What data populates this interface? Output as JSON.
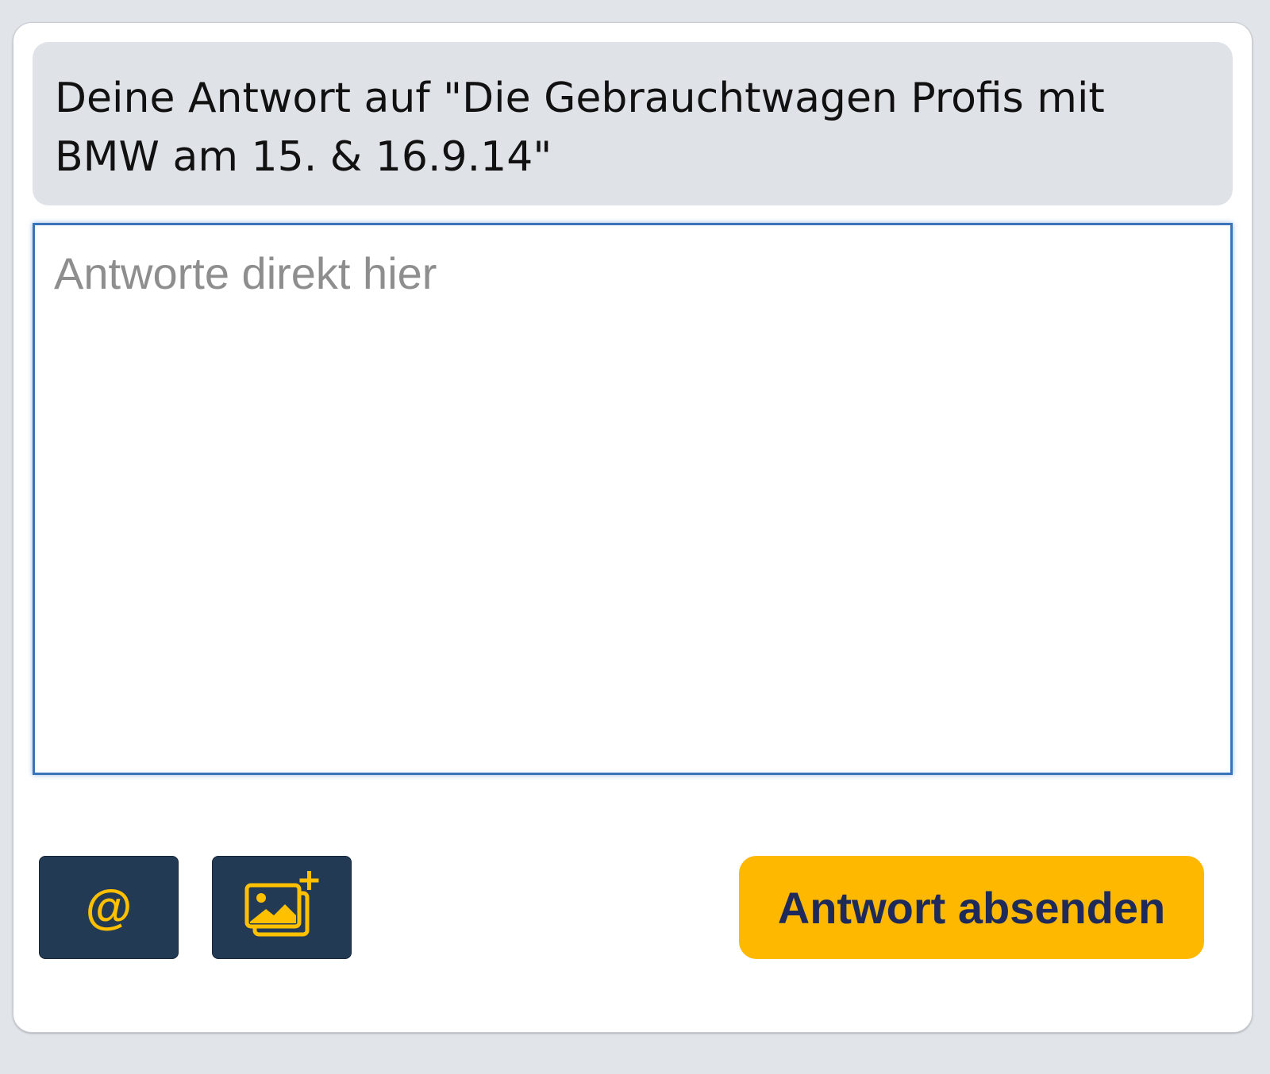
{
  "reply_form": {
    "heading": "Deine Antwort auf \"Die Gebrauchtwagen Profis mit BMW am 15. & 16.9.14\"",
    "textarea": {
      "value": "",
      "placeholder": "Antworte direkt hier"
    },
    "toolbar": {
      "mention_icon": "at-sign-icon",
      "mention_glyph": "@",
      "image_icon": "add-image-icon"
    },
    "send_button_label": "Antwort absenden"
  },
  "colors": {
    "page_background": "#e1e5e9",
    "heading_background": "#dfe3e8",
    "textarea_focus_border": "#3a73b8",
    "tool_button_background": "#233a55",
    "tool_icon_color": "#ffc000",
    "send_button_background": "#ffb800",
    "send_button_text": "#1d2a5a"
  }
}
